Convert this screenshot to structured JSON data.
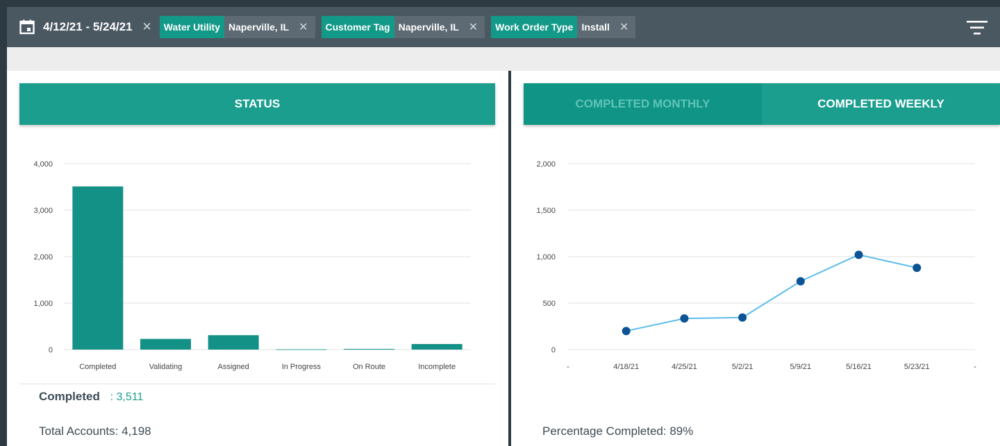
{
  "filters": {
    "date_range": "4/12/21 - 5/24/21",
    "close_glyph": "✕",
    "chips": [
      {
        "label": "Water Utility",
        "value": "Naperville, IL"
      },
      {
        "label": "Customer Tag",
        "value": "Naperville, IL"
      },
      {
        "label": "Work Order Type",
        "value": "Install"
      }
    ]
  },
  "status_panel": {
    "header": "STATUS",
    "completed_label": "Completed",
    "completed_value": ": 3,511",
    "total_accounts": "Total Accounts: 4,198"
  },
  "completed_panel": {
    "tabs": [
      "COMPLETED MONTHLY",
      "COMPLETED WEEKLY"
    ],
    "active_tab": "COMPLETED WEEKLY",
    "percentage": "Percentage Completed: 89%"
  },
  "colors": {
    "accent": "#1b9e8e",
    "topbar": "#4a5862",
    "line": "#5bbcea",
    "point": "#0b5394"
  },
  "icons": [
    "calendar-icon",
    "close-icon",
    "filter-menu-icon"
  ],
  "chart_data": [
    {
      "type": "bar",
      "categories": [
        "Completed",
        "Validating",
        "Assigned",
        "In Progress",
        "On Route",
        "Incomplete"
      ],
      "values": [
        3511,
        230,
        310,
        5,
        15,
        120
      ],
      "ylim": [
        0,
        4000
      ],
      "yticks": [
        0,
        1000,
        2000,
        3000,
        4000
      ],
      "ytick_labels": [
        "0",
        "1,000",
        "2,000",
        "3,000",
        "4,000"
      ],
      "grid": true,
      "color": "#139186"
    },
    {
      "type": "line",
      "x": [
        "4/18/21",
        "4/25/21",
        "5/2/21",
        "5/9/21",
        "5/16/21",
        "5/23/21"
      ],
      "xtick_labels": [
        "-",
        "4/18/21",
        "4/25/21",
        "5/2/21",
        "5/9/21",
        "5/16/21",
        "5/23/21",
        "-"
      ],
      "values": [
        200,
        335,
        345,
        735,
        1020,
        880
      ],
      "ylim": [
        0,
        2000
      ],
      "yticks": [
        0,
        500,
        1000,
        1500,
        2000
      ],
      "ytick_labels": [
        "0",
        "500",
        "1,000",
        "1,500",
        "2,000"
      ],
      "grid": true
    }
  ]
}
